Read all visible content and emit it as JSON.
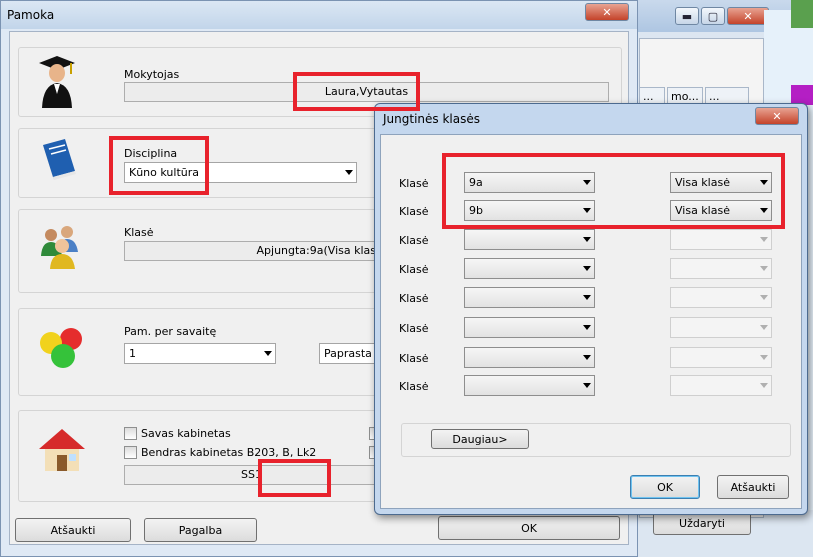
{
  "background_window": {
    "col_headers": [
      "...",
      "mo...",
      "..."
    ],
    "close_button_label": "Uždaryti",
    "caption": {
      "minimize": "▬",
      "maximize": "▢",
      "close": "✕"
    }
  },
  "main_window": {
    "title": "Pamoka",
    "close_label": "✕",
    "teacher": {
      "label": "Mokytojas",
      "value": "Laura,Vytautas"
    },
    "subject": {
      "label": "Disciplina",
      "value": "Kūno kultūra"
    },
    "class": {
      "label": "Klasė",
      "value": "Apjungta:9a(Visa klas"
    },
    "hours": {
      "label": "Pam. per savaitę",
      "value": "1",
      "type_value": "Paprasta"
    },
    "rooms": {
      "own_room_label": "Savas kabinetas",
      "shared_rooms_label": "Bendras kabinetas B203, B, Lk2",
      "room_value": "SS1"
    },
    "buttons": {
      "cancel": "Atšaukti",
      "help": "Pagalba",
      "ok": "OK"
    }
  },
  "dialog": {
    "title": "Jungtinės klasės",
    "close_label": "✕",
    "rows": [
      {
        "label": "Klasė",
        "class": "9a",
        "part": "Visa klasė"
      },
      {
        "label": "Klasė",
        "class": "9b",
        "part": "Visa klasė"
      },
      {
        "label": "Klasė",
        "class": "",
        "part": ""
      },
      {
        "label": "Klasė",
        "class": "",
        "part": ""
      },
      {
        "label": "Klasė",
        "class": "",
        "part": ""
      },
      {
        "label": "Klasė",
        "class": "",
        "part": ""
      },
      {
        "label": "Klasė",
        "class": "",
        "part": ""
      },
      {
        "label": "Klasė",
        "class": "",
        "part": ""
      }
    ],
    "more_button": "Daugiau>",
    "ok_button": "OK",
    "cancel_button": "Atšaukti"
  },
  "colors": {
    "highlight": "#e8222c"
  }
}
